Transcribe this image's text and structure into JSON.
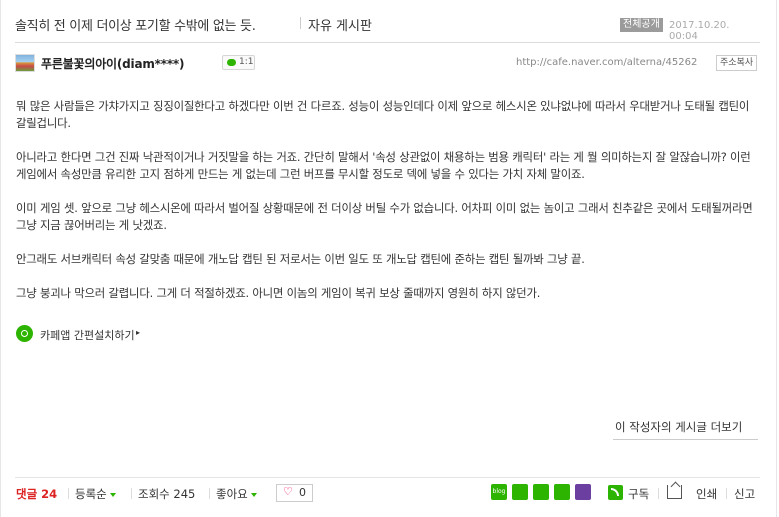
{
  "post": {
    "title": "솔직히 전 이제 더이상 포기할 수밖에 없는 듯.",
    "board": "자유 게시판",
    "scope_badge": "전체공개",
    "date": "2017.10.20. 00:04"
  },
  "author": {
    "name": "푸른불꽃의아이(diam****)",
    "chat_count": "1:1",
    "url": "http://cafe.naver.com/alterna/45262",
    "copy_url_label": "주소복사"
  },
  "body": {
    "paragraphs": [
      "뭐 많은 사람들은 가챠가지고 징징이질한다고 하겠다만 이번 건 다르죠. 성능이 성능인데다 이제 앞으로 헤스시온 있냐없냐에 따라서 우대받거나 도태될 캡틴이 갈릴겁니다.",
      "아니라고 한다면 그건 진짜 낙관적이거나 거짓말을 하는 거죠. 간단히 말해서 '속성 상관없이 채용하는 범용 캐릭터' 라는 게 뭘 의미하는지 잘 알잖습니까? 이런 게임에서 속성만큼 유리한 고지 점하게 만드는 게 없는데 그런 버프를 무시할 정도로 덱에 넣을 수 있다는 가치 자체 말이죠.",
      "이미 게임 셋. 앞으로 그냥 헤스시온에 따라서 벌어질 상황때문에 전 더이상 버틸 수가 없습니다. 어차피 이미 없는 놈이고 그래서 친추같은 곳에서 도태될꺼라면 그냥 지금 끊어버리는 게 낫겠죠.",
      "안그래도 서브캐릭터 속성 갈맞춤 때문에 개노답 캡틴 된 저로서는 이번 일도 또 개노답 캡틴에 준하는 캡틴 될까봐 그냥 끝.",
      "그냥 붕괴나 막으러 갈렵니다. 그게 더 적절하겠죠. 아니면 이놈의 게임이 복귀 보상 줄때까지 영원히 하지 않던가."
    ],
    "app_link": "카페앱 간편설치하기"
  },
  "more_posts_label": "이 작성자의 게시글 더보기",
  "footer": {
    "comment_label": "댓글 24",
    "sort_label": "등록순",
    "views_label": "조회수 245",
    "likes_label": "좋아요",
    "like_count": "0",
    "share_icons": [
      {
        "name": "blog-share-icon",
        "color": "#2db400",
        "text": "blog"
      },
      {
        "name": "cafe-share-icon",
        "color": "#2db400",
        "text": ""
      },
      {
        "name": "band-share-icon",
        "color": "#2db400",
        "text": ""
      },
      {
        "name": "memo-share-icon",
        "color": "#2db400",
        "text": ""
      },
      {
        "name": "plus-share-icon",
        "color": "#6b3fa0",
        "text": ""
      }
    ],
    "subscribe_label": "구독",
    "print_label": "인쇄",
    "report_label": "신고"
  }
}
